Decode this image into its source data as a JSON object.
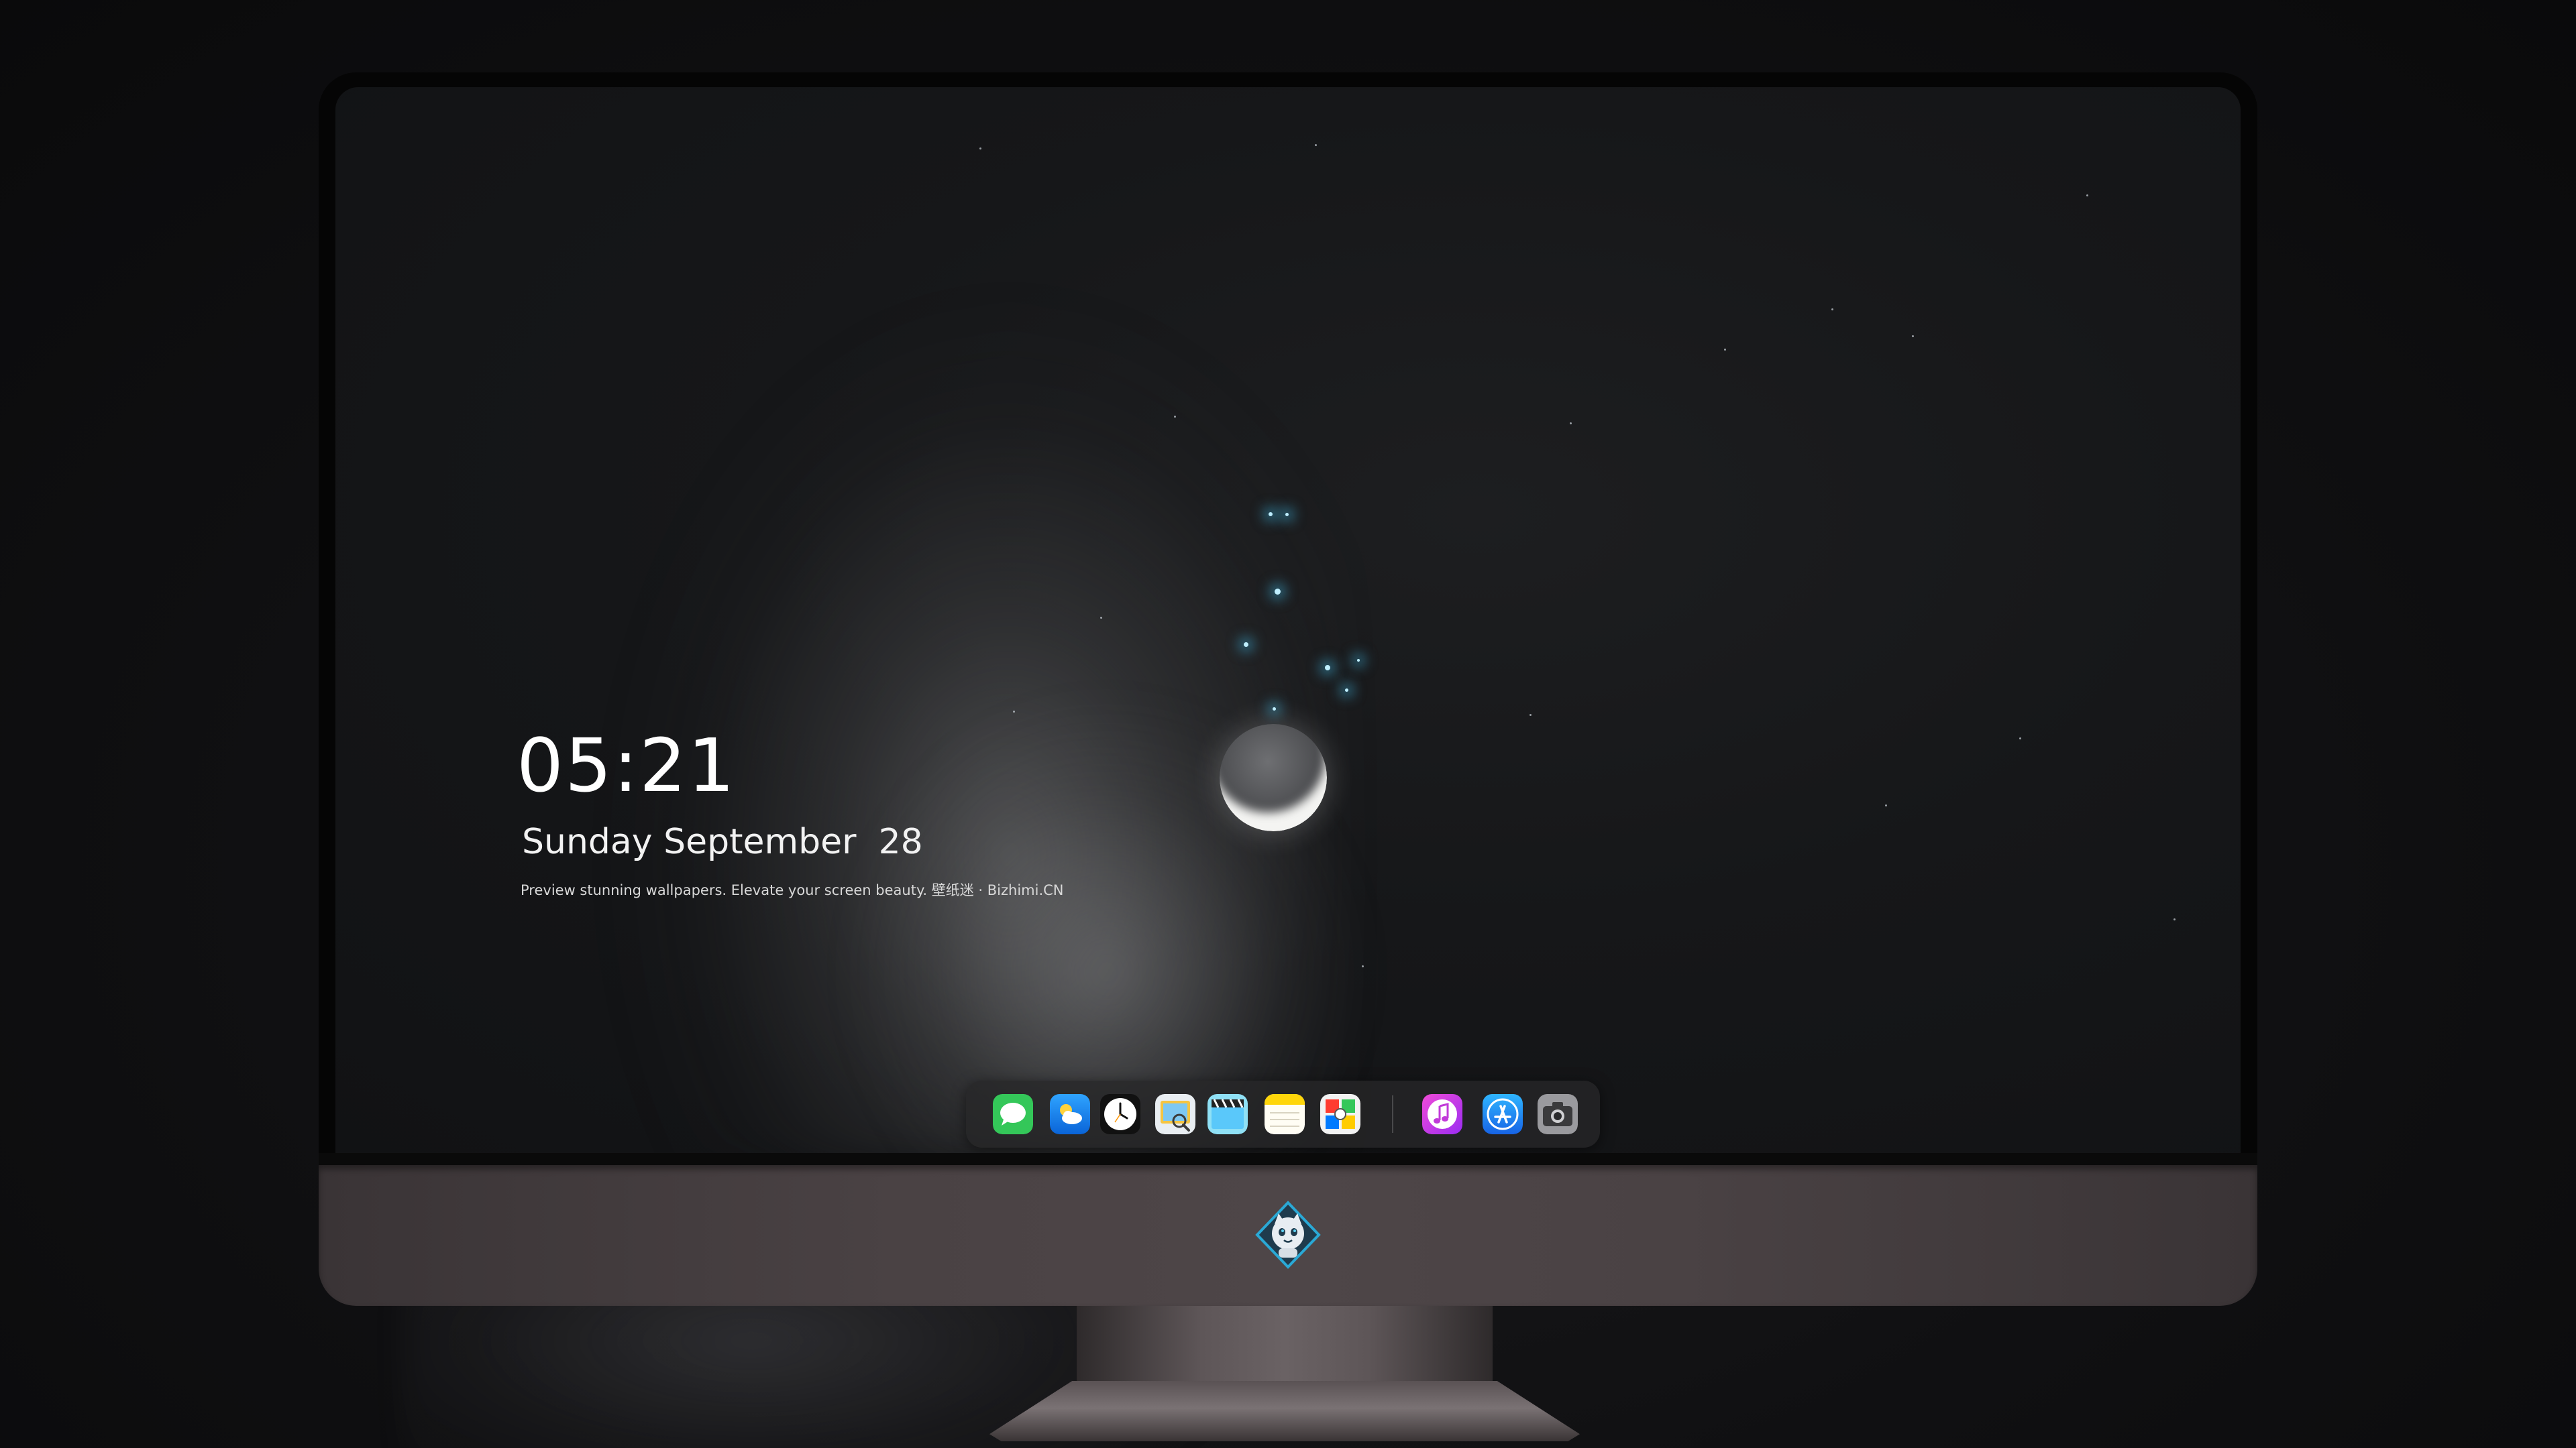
{
  "lockscreen": {
    "time": "05:21",
    "date": "Sunday September  28",
    "tagline": "Preview stunning wallpapers. Elevate your screen beauty. 壁纸迷 · Bizhimi.CN"
  },
  "dock": {
    "apps": [
      {
        "icon": "messages-icon",
        "color": "#34c759"
      },
      {
        "icon": "weather-icon",
        "color": "#1e90ff"
      },
      {
        "icon": "clock-icon",
        "color": "#ffffff"
      },
      {
        "icon": "preview-icon",
        "color": "#f5c542"
      },
      {
        "icon": "clips-icon",
        "color": "#5ac8fa"
      },
      {
        "icon": "notes-icon",
        "color": "#ffd60a"
      },
      {
        "icon": "photo-booth-icon",
        "color": "#ff3b30"
      },
      {
        "icon": "music-icon",
        "color": "#d63be0"
      },
      {
        "icon": "app-store-icon",
        "color": "#1a8cff"
      },
      {
        "icon": "camera-icon",
        "color": "#8e8e93"
      }
    ]
  },
  "monitor": {
    "logo_icon": "mascot-logo-icon"
  }
}
